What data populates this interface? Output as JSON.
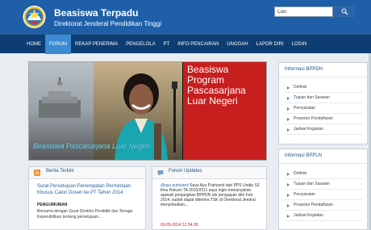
{
  "header": {
    "title": "Beasiswa Terpadu",
    "subtitle": "Direktorat Jenderal Pendidikan Tinggi",
    "search_value": "Cari"
  },
  "nav": {
    "items": [
      {
        "label": "HOME"
      },
      {
        "label": "FORUM",
        "active": true
      },
      {
        "label": "REKAP PENERIMA"
      },
      {
        "label": "PENGELOLA"
      },
      {
        "label": "PT"
      },
      {
        "label": "INFO PENCAIRAN"
      },
      {
        "label": "UNGGAH"
      },
      {
        "label": "LAPOR DIRI"
      },
      {
        "label": "LOGIN"
      }
    ]
  },
  "banner": {
    "title": "Beasiswa\nProgram\nPascasarjana\nLuar Negeri",
    "caption": "Beasiswa Pascasarjana Luar Negeri"
  },
  "news": {
    "title": "Berita Terkini",
    "headline": "Surat Persetujuan Penempatan Permintaan Khusus Calon Dosen ke PT Tahun 2014",
    "subhead": "PENGUMUMAN",
    "body": "Bersama dengan Surat Direktur Pendidik dan Tenaga Kependidikan tentang persetujuan..."
  },
  "forum": {
    "title": "Forum Updates",
    "user": "@ayu putriyanti",
    "text": " Saya Ayu Putriyanti dari PPS Undip S3 Ilmu Hukum TA 2010/2011 saya ingin menanyakan apakah penjangkan BPPDN utk pengajuan blin Feb 2014, sudah dapat diterima TSK di Direktorat Jendral menyebutkan...",
    "date": "03-09-2014 12:34:28"
  },
  "sidebar": {
    "bppdn": {
      "title": "Informasi BPPDN",
      "items": [
        {
          "label": "Definisi"
        },
        {
          "label": "Tujuan dan Sasaran"
        },
        {
          "label": "Persyaratan"
        },
        {
          "label": "Prosedur Pendaftaran"
        },
        {
          "label": "Jadwal Kegiatan"
        }
      ]
    },
    "bppln": {
      "title": "Informasi BPPLN",
      "items": [
        {
          "label": "Definisi"
        },
        {
          "label": "Tujuan dan Sasaran"
        },
        {
          "label": "Persyaratan"
        },
        {
          "label": "Prosedur Pendaftaran"
        },
        {
          "label": "Jadwal Kegiatan"
        }
      ]
    }
  },
  "colors": {
    "header": "#1f5fa8",
    "nav": "#0e3d73",
    "active": "#3a8bd4",
    "hero": "#c61f1e"
  }
}
